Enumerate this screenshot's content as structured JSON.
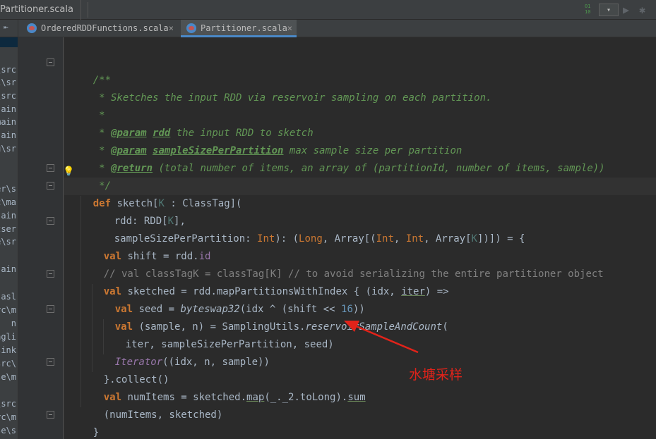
{
  "breadcrumb": {
    "file": "Partitioner.scala"
  },
  "toolbar": {
    "run_config_label": "▾",
    "binary_icon_text": "01\n10"
  },
  "tabs": [
    {
      "label": "OrderedRDDFunctions.scala",
      "close": "×"
    },
    {
      "label": "Partitioner.scala",
      "close": "×"
    }
  ],
  "project_tree_fragments": [
    "\\src",
    "l\\sr",
    "\\src",
    "ain",
    "main",
    "ain",
    "g\\sr",
    "er\\s",
    "rc\\ma",
    "ain",
    "tser",
    "e\\sr",
    "ain",
    "-asl",
    "rc\\m",
    "n",
    "ngli",
    "sink",
    "src\\",
    "se\\m",
    "\\src",
    "rc\\m",
    "se\\s"
  ],
  "code": {
    "doc_open": "/**",
    "doc_line1": " * Sketches the input RDD via reservoir sampling on each partition.",
    "doc_blank": " *",
    "param_tag": "@param",
    "param_rdd_name": "rdd",
    "param_rdd_desc": " the input RDD to sketch",
    "param_size_name": "sampleSizePerPartition",
    "param_size_desc": " max sample size per partition",
    "return_tag": "@return",
    "return_desc": " (total number of items, an array of (partitionId, number of items, sample))",
    "doc_close": " */",
    "def_kw": "def",
    "def_name": "sketch",
    "def_tparam": "K",
    "def_bound": " : ClassTag](",
    "arg_rdd": "rdd: RDD[",
    "arg_rdd_K": "K",
    "arg_rdd_end": "],",
    "arg_size": "sampleSizePerPartition: ",
    "type_int": "Int",
    "sig_mid": "): (",
    "type_long": "Long",
    "sig_arr": ", Array[(",
    "sig_int_comma": ", ",
    "sig_arr2": ", Array[",
    "sig_end": "])]) = {",
    "val_kw": "val",
    "shift_stmt": " shift = rdd.",
    "shift_id": "id",
    "comment_line": "// val classTagK = classTag[K] // to avoid serializing the entire partitioner object",
    "sketched_stmt": " sketched = rdd.mapPartitionsWithIndex { (idx, ",
    "iter_word": "iter",
    "sketched_end": ") =>",
    "seed_stmt": " seed = ",
    "byteswap": "byteswap32",
    "seed_args": "(idx ^ (shift << ",
    "seed_num": "16",
    "seed_end": "))",
    "sample_stmt": " (sample, n) = SamplingUtils.",
    "reservoir_fn": "reservoirSampleAndCount",
    "sample_end": "(",
    "iter_args": "iter, sampleSizePerPartition, seed)",
    "iterator_word": "Iterator",
    "iterator_args": "((idx, n, sample))",
    "collect_line": "}.collect()",
    "numitems_stmt": " numItems = sketched.",
    "map_word": "map",
    "map_args": "(_._2.toLong).",
    "sum_word": "sum",
    "return_tuple": "(numItems, sketched)",
    "close_brace": "}"
  },
  "annotation": {
    "text": "水塘采样",
    "color": "#e2231a"
  }
}
